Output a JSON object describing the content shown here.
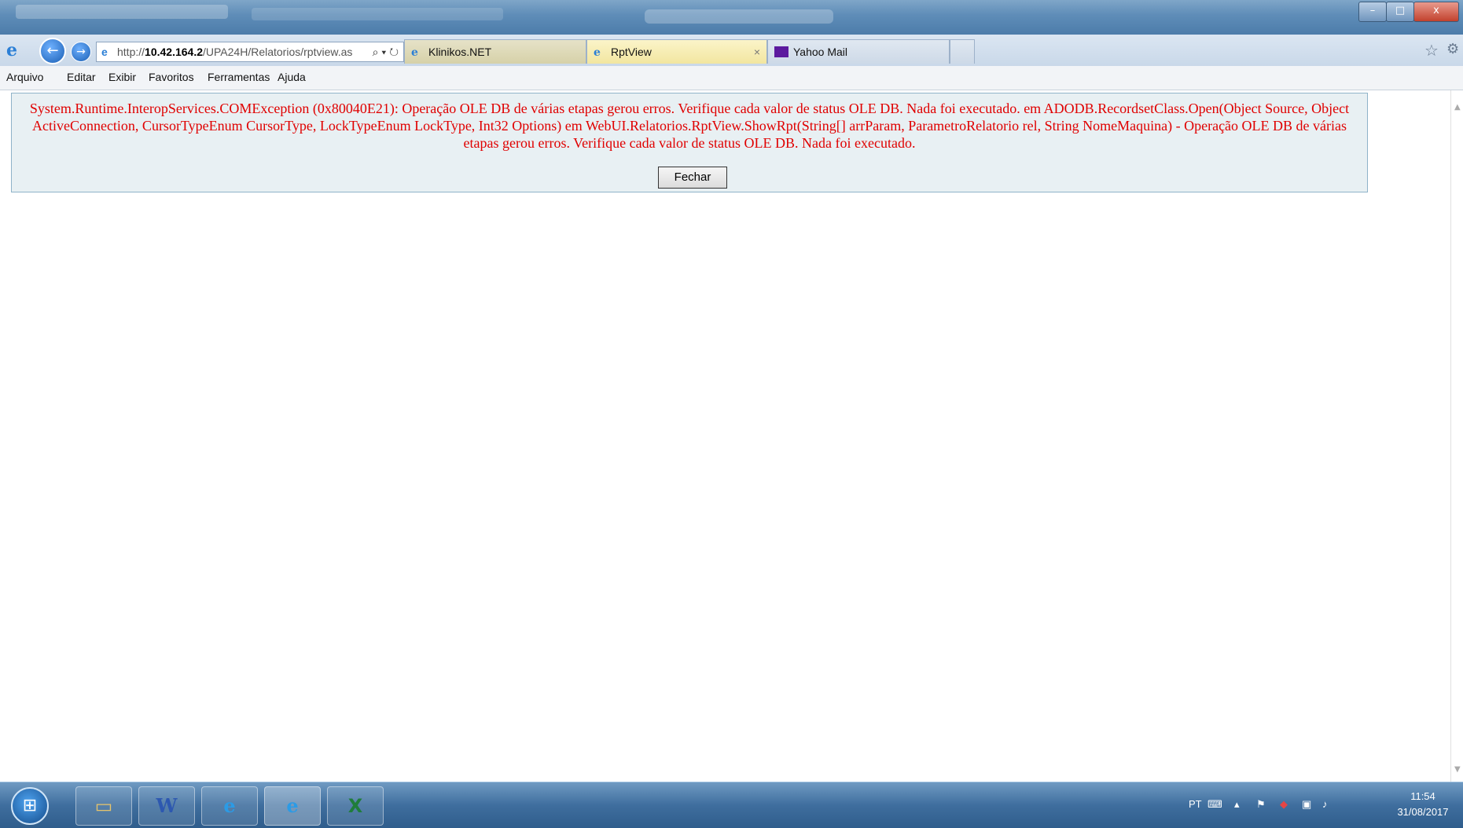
{
  "window": {
    "controls": {
      "minimize": "–",
      "maximize": "□",
      "close": "x"
    }
  },
  "navigation": {
    "back_icon": "back-arrow-icon",
    "forward_icon": "forward-arrow-icon",
    "address": {
      "scheme": "http://",
      "host": "10.42.164.2",
      "path": "/UPA24H/Relatorios/rptview.as"
    },
    "tabs": [
      {
        "label": "Klinikos.NET"
      },
      {
        "label": "RptView",
        "close": "×"
      },
      {
        "label": "Yahoo Mail"
      }
    ]
  },
  "menu": [
    "Arquivo",
    "Editar",
    "Exibir",
    "Favoritos",
    "Ferramentas",
    "Ajuda"
  ],
  "error": {
    "message": "System.Runtime.InteropServices.COMException (0x80040E21): Operação OLE DB de várias etapas gerou erros. Verifique cada valor de status OLE DB. Nada foi executado. em ADODB.RecordsetClass.Open(Object Source, Object ActiveConnection, CursorTypeEnum CursorType, LockTypeEnum LockType, Int32 Options) em WebUI.Relatorios.RptView.ShowRpt(String[] arrParam, ParametroRelatorio rel, String NomeMaquina) - Operação OLE DB de várias etapas gerou erros. Verifique cada valor de status OLE DB. Nada foi executado.",
    "button_label": "Fechar",
    "text_color": "#e00000"
  },
  "taskbar": {
    "apps": [
      "file-explorer-icon",
      "word-icon",
      "internet-explorer-icon",
      "internet-explorer-active-icon",
      "excel-icon"
    ],
    "tray": {
      "language": "PT"
    },
    "clock": {
      "time": "11:54",
      "date": "31/08/2017"
    }
  }
}
